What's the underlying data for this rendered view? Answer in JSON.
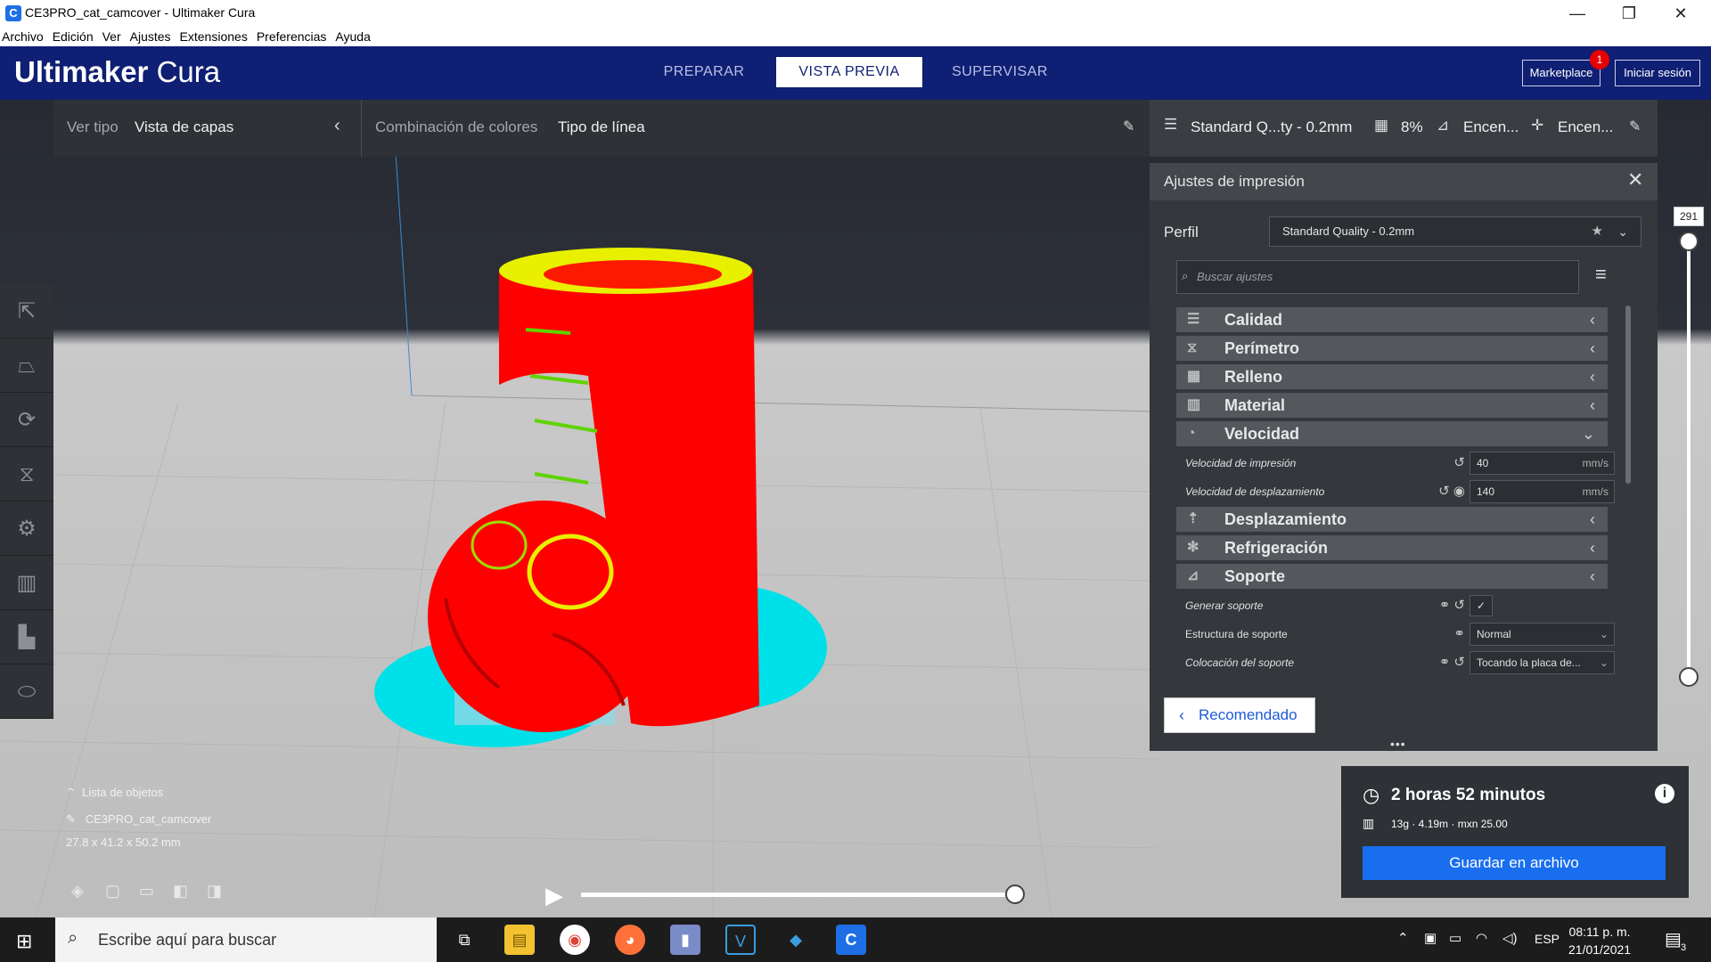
{
  "window": {
    "title": "CE3PRO_cat_camcover - Ultimaker Cura",
    "app_icon": "C",
    "controls": {
      "minimize": "—",
      "restore": "❐",
      "close": "✕"
    }
  },
  "menu": [
    "Archivo",
    "Edición",
    "Ver",
    "Ajustes",
    "Extensiones",
    "Preferencias",
    "Ayuda"
  ],
  "header": {
    "logo_bold": "Ultimaker",
    "logo_light": "Cura",
    "stages": [
      "PREPARAR",
      "VISTA PREVIA",
      "SUPERVISAR"
    ],
    "active_stage": "VISTA PREVIA",
    "marketplace_label": "Marketplace",
    "marketplace_badge": "1",
    "login_label": "Iniciar sesión"
  },
  "viewbar": {
    "view_type_label": "Ver tipo",
    "view_type_value": "Vista de capas",
    "color_scheme_label": "Combinación de colores",
    "color_scheme_value": "Tipo de línea"
  },
  "printbar": {
    "profile": "Standard Q...ty - 0.2mm",
    "infill": "8%",
    "support": "Encen...",
    "adhesion": "Encen..."
  },
  "left_tools": [
    "move-icon",
    "scale-icon",
    "rotate-icon",
    "mirror-icon",
    "per-model-settings-icon",
    "support-blocker-icon",
    "layer-view-icon",
    "model-icon"
  ],
  "panel": {
    "title": "Ajustes de impresión",
    "profile_label": "Perfil",
    "profile_value": "Standard Quality - 0.2mm",
    "search_placeholder": "Buscar ajustes",
    "categories": {
      "calidad": "Calidad",
      "perimetro": "Perímetro",
      "relleno": "Relleno",
      "material": "Material",
      "velocidad": "Velocidad",
      "desplazamiento": "Desplazamiento",
      "refrigeracion": "Refrigeración",
      "soporte": "Soporte"
    },
    "velocidad_settings": [
      {
        "label": "Velocidad de impresión",
        "value": "40",
        "unit": "mm/s"
      },
      {
        "label": "Velocidad de desplazamiento",
        "value": "140",
        "unit": "mm/s"
      }
    ],
    "soporte_settings": {
      "generar": "Generar soporte",
      "generar_checked": "✓",
      "estructura": "Estructura de soporte",
      "estructura_value": "Normal",
      "colocacion": "Colocación del soporte",
      "colocacion_value": "Tocando la placa de..."
    },
    "recommended_label": "Recomendado"
  },
  "layer_slider": {
    "value": "291"
  },
  "object_list": {
    "title": "Lista de objetos",
    "object_name": "CE3PRO_cat_camcover",
    "dimensions": "27.8 x 41.2 x 50.2 mm"
  },
  "output": {
    "time": "2 horas 52 minutos",
    "info": "13g · 4.19m · mxn 25.00",
    "save_label": "Guardar en archivo"
  },
  "taskbar": {
    "search_placeholder": "Escribe aquí para buscar",
    "language": "ESP",
    "time": "08:11 p. m.",
    "date": "21/01/2021",
    "notification_count": "3"
  },
  "colors": {
    "header": "#0f1f73",
    "wall": "#ff0000",
    "skin": "#e8f000",
    "skirt": "#00e0e8",
    "accent": "#196ef0"
  }
}
